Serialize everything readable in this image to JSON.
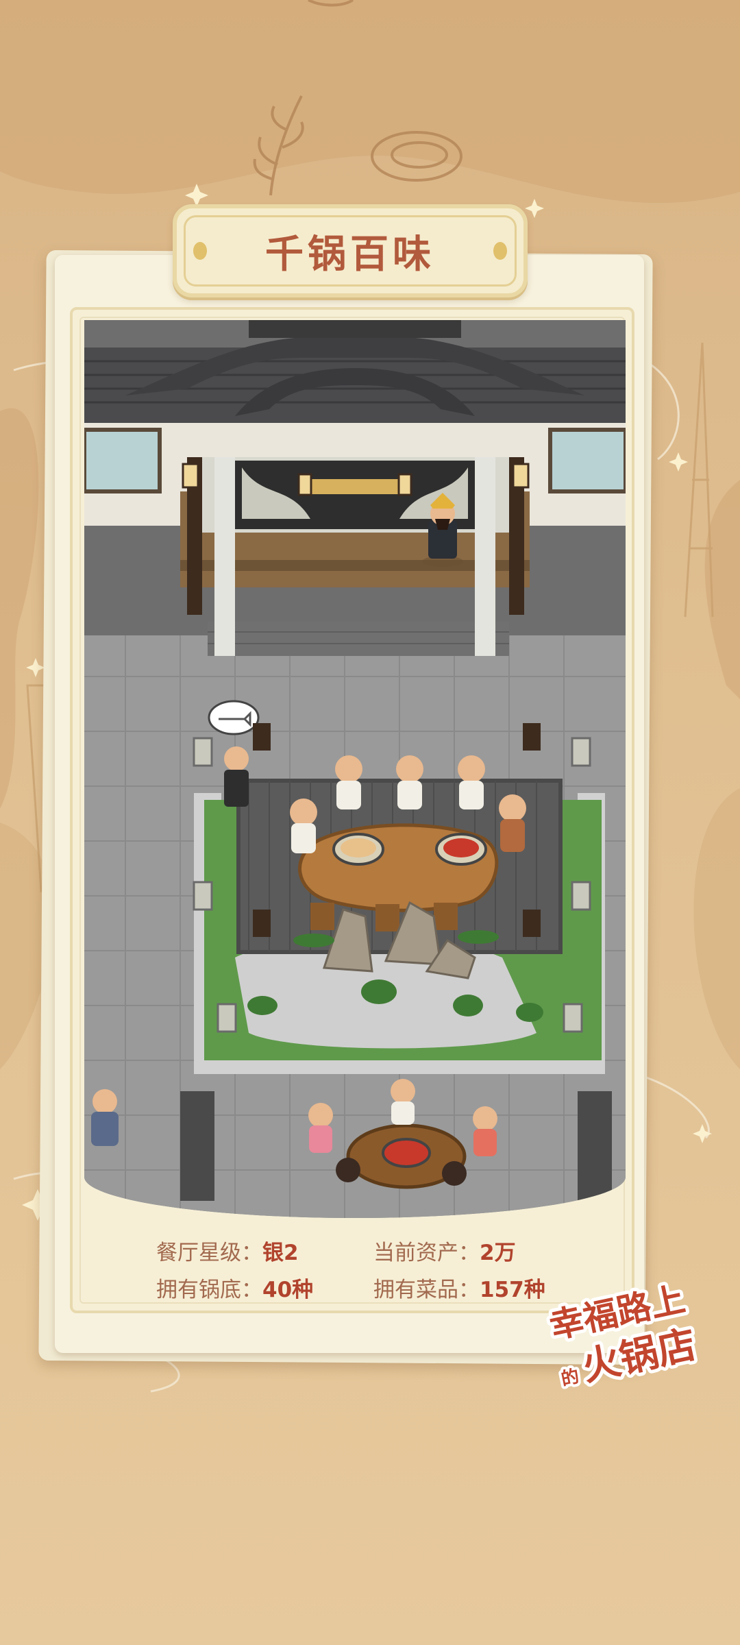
{
  "title": "千锅百味",
  "stats": [
    {
      "label": "餐厅星级：",
      "value": "银2"
    },
    {
      "label": "当前资产：",
      "value": "2万"
    },
    {
      "label": "拥有锅底：",
      "value": "40种"
    },
    {
      "label": "拥有菜品：",
      "value": "157种"
    }
  ],
  "logo": {
    "line1": "幸福路上",
    "small": "的",
    "line2": "火锅店"
  },
  "colors": {
    "background": "#e3c294",
    "card": "#f7f2de",
    "title": "#b25a3c",
    "stat_label": "#a26a4f",
    "stat_value": "#b1432d"
  },
  "icons": [
    "thought-bubble-fish-icon",
    "sparkle-icon"
  ]
}
